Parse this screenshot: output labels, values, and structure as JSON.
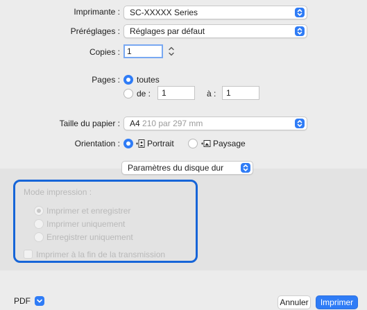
{
  "printer": {
    "label": "Imprimante :",
    "value": "SC-XXXXX Series"
  },
  "presets": {
    "label": "Préréglages :",
    "value": "Réglages par défaut"
  },
  "copies": {
    "label": "Copies :",
    "value": "1"
  },
  "pages": {
    "label": "Pages :",
    "all_label": "toutes",
    "range_from_label": "de :",
    "range_from_value": "1",
    "range_to_label": "à :",
    "range_to_value": "1"
  },
  "paper_size": {
    "label": "Taille du papier :",
    "value": "A4",
    "detail": "210 par 297 mm"
  },
  "orientation": {
    "label": "Orientation :",
    "portrait_label": "Portrait",
    "landscape_label": "Paysage"
  },
  "section_popup": {
    "value": "Paramètres du disque dur"
  },
  "print_mode": {
    "title": "Mode impression :",
    "options": [
      "Imprimer et enregistrer",
      "Imprimer uniquement",
      "Enregistrer uniquement"
    ],
    "checkbox_label": "Imprimer à la fin de la transmission"
  },
  "footer": {
    "pdf_label": "PDF",
    "cancel_label": "Annuler",
    "print_label": "Imprimer"
  },
  "colors": {
    "accent": "#2f7cf6",
    "highlight_border": "#1665d8"
  }
}
